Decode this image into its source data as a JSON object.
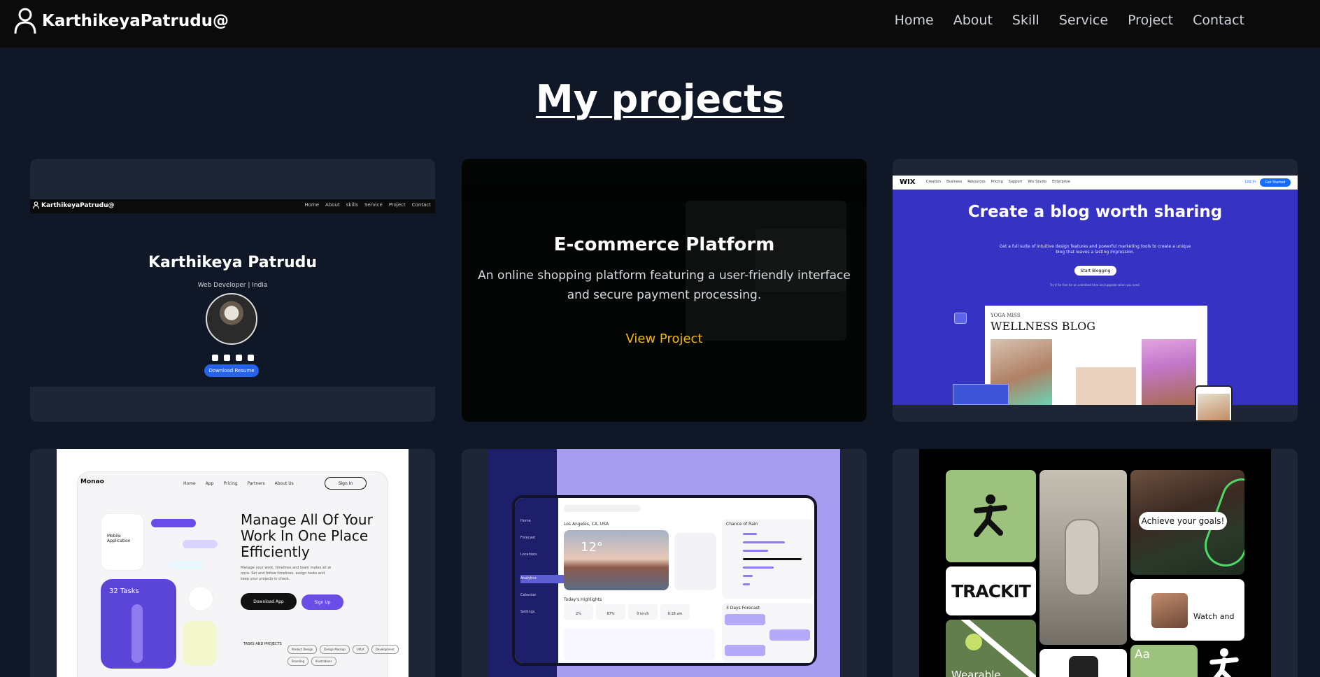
{
  "nav": {
    "brand": "KarthikeyaPatrudu@",
    "links": [
      "Home",
      "About",
      "Skill",
      "Service",
      "Project",
      "Contact"
    ]
  },
  "page": {
    "title": "My projects"
  },
  "projects": [
    {
      "preview": {
        "brand": "KarthikeyaPatrudu@",
        "nav": [
          "Home",
          "About",
          "skills",
          "Service",
          "Project",
          "Contact"
        ],
        "name": "Karthikeya Patrudu",
        "role": "Web Developer | India",
        "button": "Download Resume"
      }
    },
    {
      "title": "E-commerce Platform",
      "description": "An online shopping platform featuring a user-friendly interface and secure payment processing.",
      "link": "View Project"
    },
    {
      "preview": {
        "logo": "WIX",
        "menu": [
          "Creation",
          "Business",
          "Resources",
          "Pricing",
          "Support",
          "Wix Studio",
          "Enterprise"
        ],
        "login": "Log In",
        "cta": "Get Started",
        "headline": "Create a blog worth sharing",
        "sub": "Get a full suite of intuitive design features and powerful marketing tools to create a unique blog that leaves a lasting impression.",
        "button": "Start Blogging",
        "note": "Try it for free for an unlimited time and upgrade when you need.",
        "blog_small": "YOGA MISS",
        "blog_title": "WELLNESS BLOG"
      }
    },
    {
      "preview": {
        "logo": "Monao",
        "nav": [
          "Home",
          "App",
          "Pricing",
          "Partners",
          "About Us"
        ],
        "signin": "Sign In",
        "headline": "Manage All Of Your Work In One Place Efficiently",
        "copy": "Manage your work, timelines and team mates all at once. Set and follow timelines, assign tasks and keep your projects in check.",
        "download": "Download App",
        "signup": "Sign Up",
        "tasks": "32 Tasks",
        "card": "Mobile Application",
        "tasks_label": "TASKS AND PROJECTS",
        "tags": [
          "Product Design",
          "Design Mockup",
          "UI/UX",
          "Development",
          "Branding",
          "Illustrations"
        ]
      }
    },
    {
      "preview": {
        "location": "Los Angeles, CA, USA",
        "temp": "12°",
        "highlights": "Today's Highlights",
        "rain": "Chance of Rain",
        "forecast": "3 Days Forecast",
        "sidebar": [
          "Home",
          "Forecast",
          "Locations",
          "Analytics",
          "Calendar",
          "Settings"
        ],
        "stats": [
          "2%",
          "87%",
          "0 km/h",
          "6:18 am"
        ]
      }
    },
    {
      "preview": {
        "brand": "TRACKIT",
        "goal": "Achieve your goals!",
        "wearable": "Wearable",
        "watch": "Watch and",
        "aa": "Aa"
      }
    }
  ],
  "colors": {
    "background": "#101827",
    "nav": "#0b0b0b",
    "card": "#1e2636",
    "accent_link": "#f2b705"
  }
}
